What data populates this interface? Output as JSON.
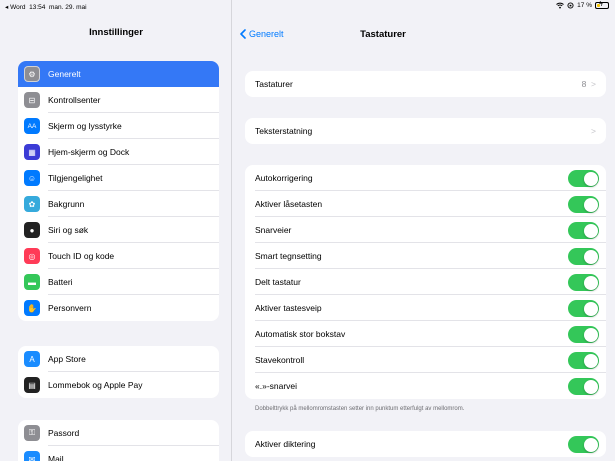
{
  "status_bar": {
    "back_app": "◂ Word",
    "time": "13:54",
    "date": "man. 29. mai",
    "battery": "17 %",
    "wifi_icon": "wifi-icon",
    "battery_accent": "#f5c400"
  },
  "sidebar": {
    "title": "Innstillinger",
    "groups": [
      [
        {
          "label": "Generelt",
          "icon": "gear-icon",
          "color": "#8e8e93",
          "glyph": "⚙",
          "active": true
        },
        {
          "label": "Kontrollsenter",
          "icon": "control-center-icon",
          "color": "#8e8e93",
          "glyph": "⊟"
        },
        {
          "label": "Skjerm og lysstyrke",
          "icon": "display-icon",
          "color": "#007aff",
          "glyph": "AA"
        },
        {
          "label": "Hjem-skjerm og Dock",
          "icon": "home-screen-icon",
          "color": "#3c3cd6",
          "glyph": "▦"
        },
        {
          "label": "Tilgjengelighet",
          "icon": "accessibility-icon",
          "color": "#007aff",
          "glyph": "☺"
        },
        {
          "label": "Bakgrunn",
          "icon": "wallpaper-icon",
          "color": "#36aadc",
          "glyph": "✿"
        },
        {
          "label": "Siri og søk",
          "icon": "siri-icon",
          "color": "#222222",
          "glyph": "●"
        },
        {
          "label": "Touch ID og kode",
          "icon": "fingerprint-icon",
          "color": "#ff3b57",
          "glyph": "◎"
        },
        {
          "label": "Batteri",
          "icon": "battery-icon",
          "color": "#34c759",
          "glyph": "▬"
        },
        {
          "label": "Personvern",
          "icon": "hand-icon",
          "color": "#007aff",
          "glyph": "✋"
        }
      ],
      [
        {
          "label": "App Store",
          "icon": "app-store-icon",
          "color": "#1a8cff",
          "glyph": "A"
        },
        {
          "label": "Lommebok og Apple Pay",
          "icon": "wallet-icon",
          "color": "#222222",
          "glyph": "▤"
        }
      ],
      [
        {
          "label": "Passord",
          "icon": "key-icon",
          "color": "#8e8e93",
          "glyph": "⚿"
        },
        {
          "label": "Mail",
          "icon": "mail-icon",
          "color": "#1a8cff",
          "glyph": "✉"
        }
      ]
    ]
  },
  "detail": {
    "back_label": "Generelt",
    "title": "Tastaturer",
    "keyboards_row": {
      "label": "Tastaturer",
      "value": "8"
    },
    "text_replacement_row": {
      "label": "Teksterstatning"
    },
    "toggles": [
      {
        "label": "Autokorrigering",
        "on": true
      },
      {
        "label": "Aktiver låsetasten",
        "on": true
      },
      {
        "label": "Snarveier",
        "on": true
      },
      {
        "label": "Smart tegnsetting",
        "on": true
      },
      {
        "label": "Delt tastatur",
        "on": true
      },
      {
        "label": "Aktiver tastesveip",
        "on": true
      },
      {
        "label": "Automatisk stor bokstav",
        "on": true
      },
      {
        "label": "Stavekontroll",
        "on": true
      },
      {
        "label": "«.»-snarvei",
        "on": true
      }
    ],
    "footnote": "Dobbelttrykk på mellomromstasten setter inn punktum etterfulgt av mellomrom.",
    "dictation": {
      "label": "Aktiver diktering",
      "on": true
    },
    "accent_color": "#34c759",
    "link_color": "#007aff"
  }
}
